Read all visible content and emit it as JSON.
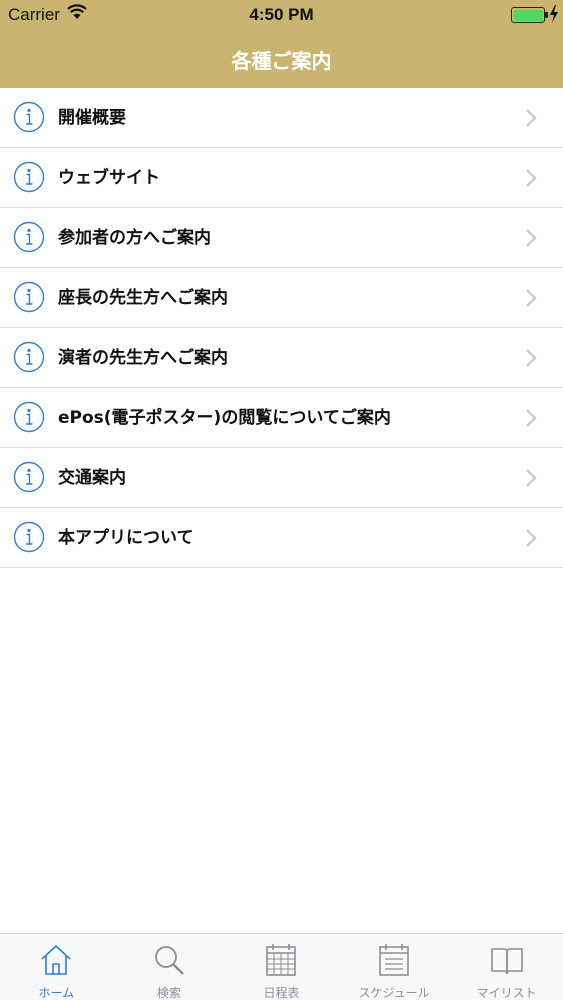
{
  "status_bar": {
    "carrier": "Carrier",
    "time": "4:50 PM",
    "battery_level": 1.0
  },
  "header": {
    "title": "各種ご案内"
  },
  "menu": {
    "items": [
      {
        "label": "開催概要",
        "icon": "info-icon"
      },
      {
        "label": "ウェブサイト",
        "icon": "info-icon"
      },
      {
        "label": "参加者の方へご案内",
        "icon": "info-icon"
      },
      {
        "label": "座長の先生方へご案内",
        "icon": "info-icon"
      },
      {
        "label": "演者の先生方へご案内",
        "icon": "info-icon"
      },
      {
        "label": "ePos(電子ポスター)の閲覧についてご案内",
        "icon": "info-icon"
      },
      {
        "label": "交通案内",
        "icon": "info-icon"
      },
      {
        "label": "本アプリについて",
        "icon": "info-icon"
      }
    ]
  },
  "tab_bar": {
    "tabs": [
      {
        "label": "ホーム",
        "icon": "home-icon",
        "active": true
      },
      {
        "label": "検索",
        "icon": "search-icon",
        "active": false
      },
      {
        "label": "日程表",
        "icon": "calendar-icon",
        "active": false
      },
      {
        "label": "スケジュール",
        "icon": "schedule-list-icon",
        "active": false
      },
      {
        "label": "マイリスト",
        "icon": "book-icon",
        "active": false
      }
    ]
  },
  "colors": {
    "header_bg": "#c9b56f",
    "accent": "#2d7fd6",
    "inactive_tab": "#8e8e93",
    "battery": "#4cd964"
  }
}
